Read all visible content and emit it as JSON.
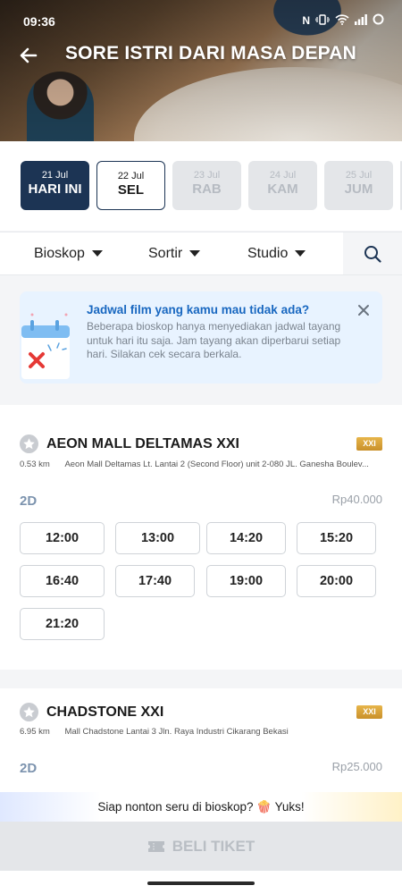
{
  "status_bar": {
    "time": "09:36"
  },
  "header": {
    "title": "SORE ISTRI DARI MASA DEPAN"
  },
  "dates": [
    {
      "date": "21 Jul",
      "day": "HARI INI",
      "state": "active"
    },
    {
      "date": "22 Jul",
      "day": "SEL",
      "state": "outline"
    },
    {
      "date": "23 Jul",
      "day": "RAB",
      "state": "disabled"
    },
    {
      "date": "24 Jul",
      "day": "KAM",
      "state": "disabled"
    },
    {
      "date": "25 Jul",
      "day": "JUM",
      "state": "disabled"
    }
  ],
  "filters": {
    "bioskop": "Bioskop",
    "sortir": "Sortir",
    "studio": "Studio"
  },
  "notice": {
    "title": "Jadwal film yang kamu mau tidak ada?",
    "text": "Beberapa bioskop hanya menyediakan jadwal tayang untuk hari itu saja. Jam tayang akan diperbarui setiap hari. Silakan cek secara berkala."
  },
  "cinemas": [
    {
      "name": "AEON MALL DELTAMAS XXI",
      "badge": "XXI",
      "distance": "0.53 km",
      "address": "Aeon Mall Deltamas  Lt. Lantai 2 (Second Floor) unit 2-080 JL. Ganesha Boulev...",
      "format": "2D",
      "price": "Rp40.000",
      "times": [
        "12:00",
        "13:00",
        "14:20",
        "15:20",
        "16:40",
        "17:40",
        "19:00",
        "20:00",
        "21:20"
      ]
    },
    {
      "name": "CHADSTONE XXI",
      "badge": "XXI",
      "distance": "6.95 km",
      "address": "Mall Chadstone Lantai 3 Jln. Raya Industri Cikarang  Bekasi",
      "format": "2D",
      "price": "Rp25.000"
    }
  ],
  "promo": {
    "text": "Siap nonton seru di bioskop? 🍿 Yuks!"
  },
  "buy": {
    "label": "BELI TIKET"
  },
  "colors": {
    "primary": "#1c3454",
    "notice_title": "#1867c0",
    "badge": "#d9a23a"
  }
}
